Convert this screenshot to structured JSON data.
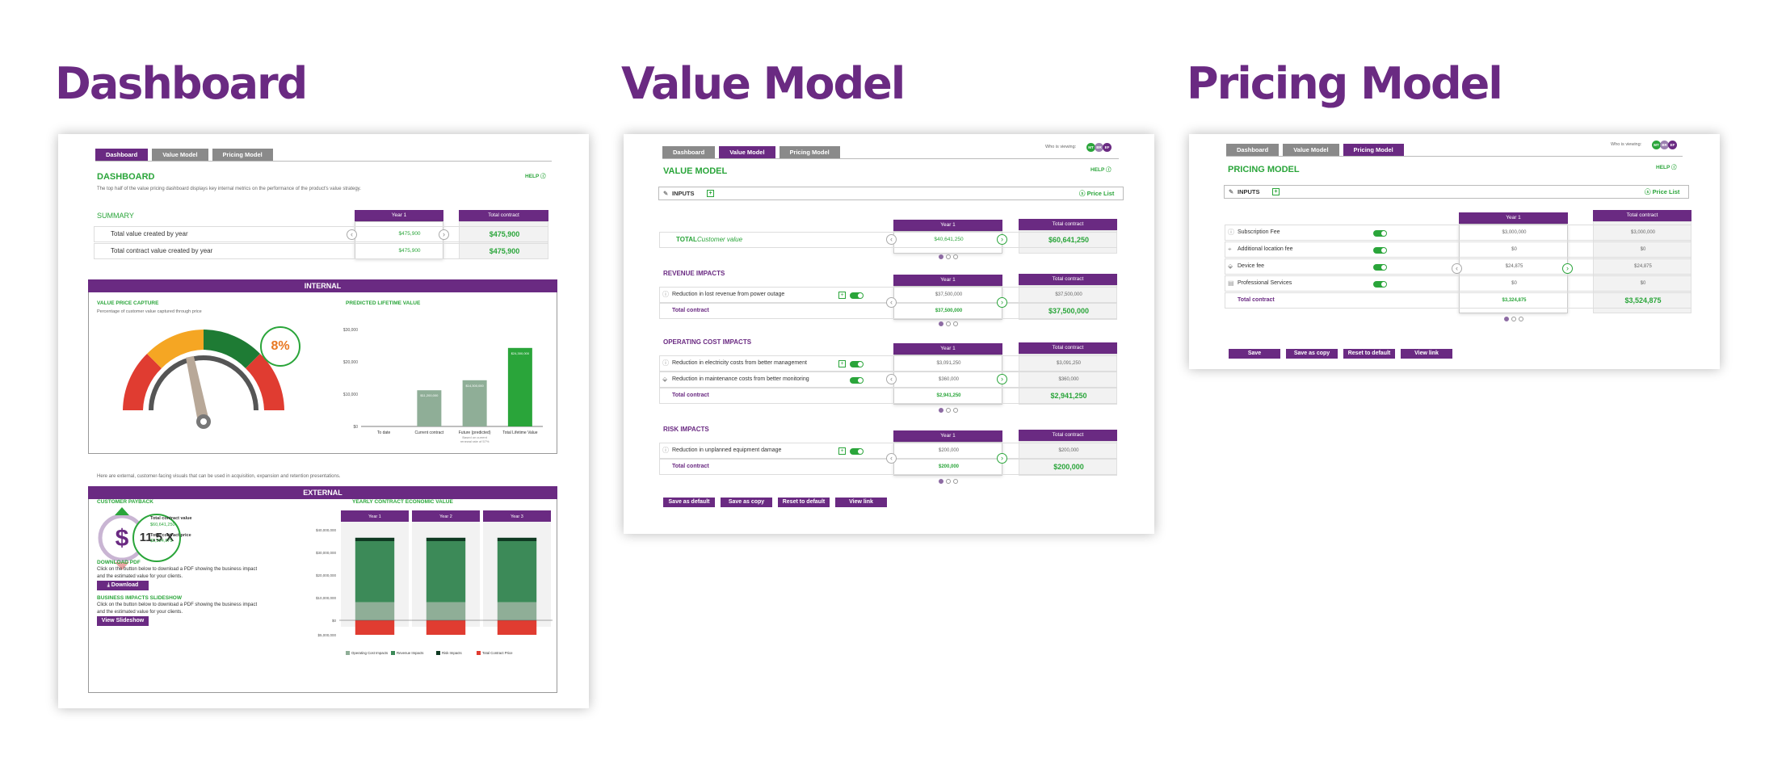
{
  "titles": {
    "dashboard": "Dashboard",
    "value_model": "Value Model",
    "pricing_model": "Pricing Model"
  },
  "tabs": [
    "Dashboard",
    "Value Model",
    "Pricing Model"
  ],
  "colors": {
    "brand_purple": "#6a2a82",
    "accent_green": "#2aa53a",
    "gauge_red": "#e03c31",
    "gauge_orange": "#f5a623",
    "gauge_green": "#1e7b34"
  },
  "dashboard": {
    "heading": "DASHBOARD",
    "help": "HELP",
    "intro": "The top half of the value pricing dashboard displays key internal metrics on the performance of the product's value strategy.",
    "summary_label": "SUMMARY",
    "col_year": "Year 1",
    "col_total": "Total contract",
    "summary_rows": [
      {
        "label": "Total value created by year",
        "year": "$475,900",
        "total": "$475,900"
      },
      {
        "label": "Total contract value created by year",
        "year": "$475,900",
        "total": "$475,900"
      }
    ],
    "internal_band": "INTERNAL",
    "vpc_title": "VALUE PRICE CAPTURE",
    "vpc_sub": "Percentage of customer value captured through price",
    "vpc_percent": "8%",
    "vpc_percent_value": 8,
    "plv_title": "PREDICTED LIFETIME VALUE",
    "plv_chart": {
      "type": "bar",
      "categories": [
        "To date",
        "Current contract",
        "Future (predicted)",
        "Total Lifetime Value"
      ],
      "values": [
        0,
        11200000,
        14300000,
        24300000
      ],
      "data_labels": [
        "",
        "$11,200,000",
        "$14,300,000",
        "$24,300,000"
      ],
      "y_ticks": [
        "$0",
        "$10,000",
        "$20,000",
        "$30,000"
      ],
      "ylim": [
        0,
        30000000
      ],
      "note": "Based on current renewal rate of 57%"
    },
    "external_intro": "Here are external, customer-facing visuals that can be used in acquisition, expansion and retention presentations.",
    "external_band": "EXTERNAL",
    "payback_title": "CUSTOMER PAYBACK",
    "payback_value": "11.5 X",
    "payback_symbol": "$",
    "total_contract_value_label": "Total contract value",
    "total_contract_value": "$60,641,250",
    "total_contract_price_label": "Total contract price",
    "total_contract_price": "$3,324,875",
    "download_title": "DOWNLOAD PDF",
    "download_text": "Click on the button below to download a PDF showing the business impact and the estimated value for your clients.",
    "download_btn": "Download",
    "slideshow_title": "BUSINESS IMPACTS SLIDESHOW",
    "slideshow_text": "Click on the button below to download a PDF showing the business impact and the estimated value for your clients.",
    "slideshow_btn": "View Slideshow",
    "yearly_title": "YEARLY CONTRACT ECONOMIC VALUE",
    "yearly_chart": {
      "type": "bar",
      "categories": [
        "Year 1",
        "Year 2",
        "Year 3"
      ],
      "y_ticks": [
        "$40,000,000",
        "$30,000,000",
        "$20,000,000",
        "$10,000,000",
        "$0",
        "$5,000,000"
      ],
      "ylim": [
        -5000000,
        40000000
      ],
      "series": [
        {
          "name": "Operating Cost Impacts",
          "values": [
            8000000,
            8000000,
            8000000
          ],
          "color": "#8fae97"
        },
        {
          "name": "Revenue Impacts",
          "values": [
            27000000,
            27000000,
            27000000
          ],
          "color": "#3c8a58"
        },
        {
          "name": "Risk Impacts",
          "values": [
            1500000,
            1500000,
            1500000
          ],
          "color": "#0f3a22"
        },
        {
          "name": "Total Contract Price",
          "values": [
            -5500000,
            -5500000,
            -5500000
          ],
          "color": "#e03c31"
        }
      ]
    }
  },
  "value_model": {
    "heading": "VALUE MODEL",
    "help": "HELP",
    "who_viewing": "Who is viewing:",
    "avatars": [
      "MT",
      "BR",
      "EF"
    ],
    "inputs": "INPUTS",
    "price_list": "Price List",
    "col_year": "Year 1",
    "col_total": "Total contract",
    "total_label": "TOTAL",
    "total_sub": "Customer value",
    "total_year": "$40,641,250",
    "total_contract": "$60,641,250",
    "sections": [
      {
        "title": "REVENUE IMPACTS",
        "rows": [
          {
            "label": "Reduction in lost revenue from power outage",
            "year": "$37,500,000",
            "total": "$37,500,000"
          }
        ],
        "total_label": "Total contract",
        "total_year": "$37,500,000",
        "total_total": "$37,500,000"
      },
      {
        "title": "OPERATING COST IMPACTS",
        "rows": [
          {
            "label": "Reduction in electricity costs from better management",
            "year": "$3,091,250",
            "total": "$3,091,250"
          },
          {
            "label": "Reduction in maintenance costs from better monitoring",
            "year": "$360,000",
            "total": "$360,000"
          }
        ],
        "total_label": "Total contract",
        "total_year": "$2,941,250",
        "total_total": "$2,941,250"
      },
      {
        "title": "RISK IMPACTS",
        "rows": [
          {
            "label": "Reduction in unplanned equipment damage",
            "year": "$200,000",
            "total": "$200,000"
          }
        ],
        "total_label": "Total contract",
        "total_year": "$200,000",
        "total_total": "$200,000"
      }
    ],
    "buttons": [
      "Save as default",
      "Save as copy",
      "Reset to default",
      "View link"
    ]
  },
  "pricing_model": {
    "heading": "PRICING MODEL",
    "help": "HELP",
    "who_viewing": "Who is viewing:",
    "avatars": [
      "MT",
      "BR",
      "EF"
    ],
    "inputs": "INPUTS",
    "price_list": "Price List",
    "col_year": "Year 1",
    "col_total": "Total contract",
    "rows": [
      {
        "label": "Subscription Fee",
        "year": "$3,000,000",
        "total": "$3,000,000"
      },
      {
        "label": "Additional location fee",
        "year": "$0",
        "total": "$0"
      },
      {
        "label": "Device fee",
        "year": "$24,875",
        "total": "$24,875"
      },
      {
        "label": "Professional Services",
        "year": "$0",
        "total": "$0"
      }
    ],
    "total_label": "Total contract",
    "total_year": "$3,324,875",
    "total_total": "$3,524,875",
    "buttons": [
      "Save",
      "Save as copy",
      "Reset to default",
      "View link"
    ]
  }
}
